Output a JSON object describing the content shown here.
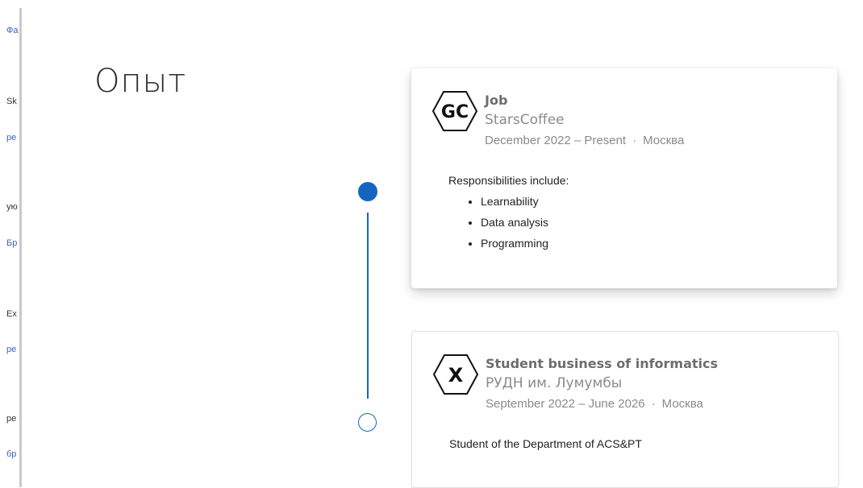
{
  "left_fragments": [
    "Фа",
    "Sk",
    "ре",
    "ую",
    "Бр",
    "Ex",
    "ре",
    "ре",
    "бр"
  ],
  "section": {
    "title": "Опыт"
  },
  "colors": {
    "accent": "#1565c0",
    "muted": "#8a8a8a"
  },
  "experience": [
    {
      "logo_icon": "gc-logo-icon",
      "logo_text": "GC",
      "role": "Job",
      "organization": "StarsCoffee",
      "dates": "December 2022 – Present",
      "separator": "·",
      "location": "Москва",
      "description_intro": "Responsibilities include:",
      "bullets": [
        "Learnability",
        "Data analysis",
        "Programming"
      ]
    },
    {
      "logo_icon": "x-logo-icon",
      "logo_text": "X",
      "role": "Student business of informatics",
      "organization": "РУДН им. Лумумбы",
      "dates": "September 2022 – June 2026",
      "separator": "·",
      "location": "Москва",
      "description": "Student of the Department of ACS&PT"
    }
  ]
}
